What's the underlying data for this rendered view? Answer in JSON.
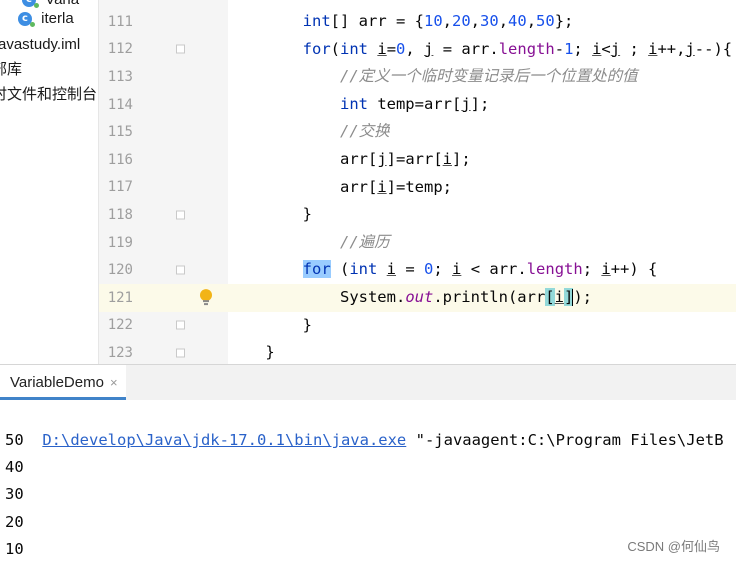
{
  "project_tree": [
    {
      "text": "Varia",
      "icon": "java-class-icon"
    },
    {
      "text": "iterla",
      "icon": "java-class-icon"
    },
    {
      "text": "avastudy.iml"
    },
    {
      "text": "部库"
    },
    {
      "text": "时文件和控制台"
    }
  ],
  "editor": {
    "current_line": "121",
    "lines": [
      {
        "n": "111",
        "fold": false,
        "segs": [
          [
            "        ",
            ""
          ],
          [
            "int",
            "kw"
          ],
          [
            "[] arr = {",
            ""
          ],
          [
            "10",
            "num"
          ],
          [
            ",",
            ""
          ],
          [
            "20",
            "num"
          ],
          [
            ",",
            ""
          ],
          [
            "30",
            "num"
          ],
          [
            ",",
            ""
          ],
          [
            "40",
            "num"
          ],
          [
            ",",
            ""
          ],
          [
            "50",
            "num"
          ],
          [
            "};",
            ""
          ]
        ]
      },
      {
        "n": "112",
        "fold": true,
        "segs": [
          [
            "        ",
            ""
          ],
          [
            "for",
            "kw"
          ],
          [
            "(",
            ""
          ],
          [
            "int",
            "kw"
          ],
          [
            " ",
            ""
          ],
          [
            "i",
            "u"
          ],
          [
            "=",
            ""
          ],
          [
            "0",
            "num"
          ],
          [
            ", ",
            ""
          ],
          [
            "j",
            "u"
          ],
          [
            " = arr.",
            ""
          ],
          [
            "length",
            "fld"
          ],
          [
            "-",
            ""
          ],
          [
            "1",
            "num"
          ],
          [
            "; ",
            ""
          ],
          [
            "i",
            "u"
          ],
          [
            "<",
            ""
          ],
          [
            "j",
            "u"
          ],
          [
            " ; ",
            ""
          ],
          [
            "i",
            "u"
          ],
          [
            "++,",
            ""
          ],
          [
            "j",
            "u"
          ],
          [
            "--){",
            ""
          ]
        ]
      },
      {
        "n": "113",
        "fold": false,
        "segs": [
          [
            "            ",
            ""
          ],
          [
            "//定义一个临时变量记录后一个位置处的值",
            "cmt"
          ]
        ]
      },
      {
        "n": "114",
        "fold": false,
        "segs": [
          [
            "            ",
            ""
          ],
          [
            "int",
            "kw"
          ],
          [
            " temp=arr[",
            ""
          ],
          [
            "j",
            "u"
          ],
          [
            "];",
            ""
          ]
        ]
      },
      {
        "n": "115",
        "fold": false,
        "segs": [
          [
            "            ",
            ""
          ],
          [
            "//交换",
            "cmt"
          ]
        ]
      },
      {
        "n": "116",
        "fold": false,
        "segs": [
          [
            "            arr[",
            ""
          ],
          [
            "j",
            "u"
          ],
          [
            "]=arr[",
            ""
          ],
          [
            "i",
            "u"
          ],
          [
            "];",
            ""
          ]
        ]
      },
      {
        "n": "117",
        "fold": false,
        "segs": [
          [
            "            arr[",
            ""
          ],
          [
            "i",
            "u"
          ],
          [
            "]=temp;",
            ""
          ]
        ]
      },
      {
        "n": "118",
        "fold": true,
        "segs": [
          [
            "        }",
            ""
          ]
        ]
      },
      {
        "n": "119",
        "fold": false,
        "segs": [
          [
            "            ",
            ""
          ],
          [
            "//遍历",
            "cmt"
          ]
        ]
      },
      {
        "n": "120",
        "fold": true,
        "segs": [
          [
            "        ",
            ""
          ],
          [
            "for",
            "kw hl"
          ],
          [
            " (",
            ""
          ],
          [
            "int",
            "kw"
          ],
          [
            " ",
            ""
          ],
          [
            "i",
            "u"
          ],
          [
            " = ",
            ""
          ],
          [
            "0",
            "num"
          ],
          [
            "; ",
            ""
          ],
          [
            "i",
            "u"
          ],
          [
            " < arr.",
            ""
          ],
          [
            "length",
            "fld"
          ],
          [
            "; ",
            ""
          ],
          [
            "i",
            "u"
          ],
          [
            "++) {",
            ""
          ]
        ]
      },
      {
        "n": "121",
        "fold": false,
        "bulb": true,
        "segs": [
          [
            "            System.",
            ""
          ],
          [
            "out",
            "fld cmtI"
          ],
          [
            ".println(arr",
            ""
          ],
          [
            "[",
            "brk"
          ],
          [
            "i",
            "u"
          ],
          [
            "]",
            "brk"
          ],
          [
            "CARET",
            ""
          ],
          [
            ");",
            ""
          ]
        ]
      },
      {
        "n": "122",
        "fold": true,
        "segs": [
          [
            "        }",
            ""
          ]
        ]
      },
      {
        "n": "123",
        "fold": true,
        "segs": [
          [
            "    }",
            ""
          ]
        ]
      }
    ]
  },
  "run": {
    "tab_label": "VariableDemo",
    "close_glyph": "×",
    "command_path": "D:\\develop\\Java\\jdk-17.0.1\\bin\\java.exe",
    "command_args": " \"-javaagent:C:\\Program Files\\JetB",
    "output": [
      "50",
      "40",
      "30",
      "20",
      "10"
    ]
  },
  "watermark": "CSDN @何仙鸟",
  "colors": {
    "keyword": "#0033b3",
    "number": "#1750eb",
    "field": "#871094",
    "comment": "#8c8c8c",
    "link": "#2a62c9",
    "current_line": "#fcfae9",
    "tab_underline": "#4083c9"
  }
}
